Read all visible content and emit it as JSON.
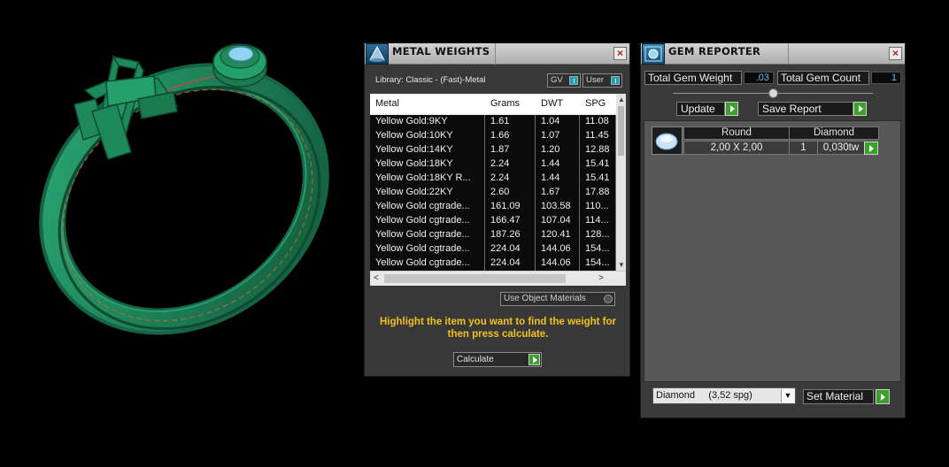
{
  "metal_weights": {
    "title": "METAL WEIGHTS",
    "library": "Library: Classic - (Fast)-Metal",
    "gv_label": "GV",
    "user_label": "User",
    "columns": [
      "Metal",
      "Grams",
      "DWT",
      "SPG"
    ],
    "rows": [
      [
        "Yellow Gold:9KY",
        "1.61",
        "1.04",
        "11.08"
      ],
      [
        "Yellow Gold:10KY",
        "1.66",
        "1.07",
        "11.45"
      ],
      [
        "Yellow Gold:14KY",
        "1.87",
        "1.20",
        "12.88"
      ],
      [
        "Yellow Gold:18KY",
        "2.24",
        "1.44",
        "15.41"
      ],
      [
        "Yellow Gold:18KY R...",
        "2.24",
        "1.44",
        "15.41"
      ],
      [
        "Yellow Gold:22KY",
        "2.60",
        "1.67",
        "17.88"
      ],
      [
        "Yellow Gold cgtrade...",
        "161.09",
        "103.58",
        "110..."
      ],
      [
        "Yellow Gold cgtrade...",
        "166.47",
        "107.04",
        "114..."
      ],
      [
        "Yellow Gold cgtrade...",
        "187.26",
        "120.41",
        "128..."
      ],
      [
        "Yellow Gold cgtrade...",
        "224.04",
        "144.06",
        "154..."
      ],
      [
        "Yellow Gold cgtrade...",
        "224.04",
        "144.06",
        "154..."
      ]
    ],
    "use_object_materials": "Use Object Materials",
    "hint": "Highlight the item you want to find the weight for then press calculate.",
    "calculate": "Calculate"
  },
  "gem_reporter": {
    "title": "GEM REPORTER",
    "total_weight_label": "Total Gem Weight",
    "total_weight_value": ".03",
    "total_count_label": "Total Gem Count",
    "total_count_value": "1",
    "update_label": "Update",
    "save_report_label": "Save Report",
    "gem_headers": [
      "Round",
      "Diamond"
    ],
    "gem_row": [
      "2,00 X 2,00",
      "1",
      "0,030tw"
    ],
    "material_select": "Diamond     (3,52 spg)",
    "set_material_label": "Set Material"
  },
  "colors": {
    "accent_green": "#3aa12a",
    "ring_green": "#1f8a5b",
    "hint_yellow": "#f2c21b"
  },
  "icons": [
    "metal-weights-icon",
    "gem-reporter-icon",
    "close-icon",
    "go-arrow-icon",
    "dropdown-arrow-icon",
    "gem-diamond-icon"
  ]
}
